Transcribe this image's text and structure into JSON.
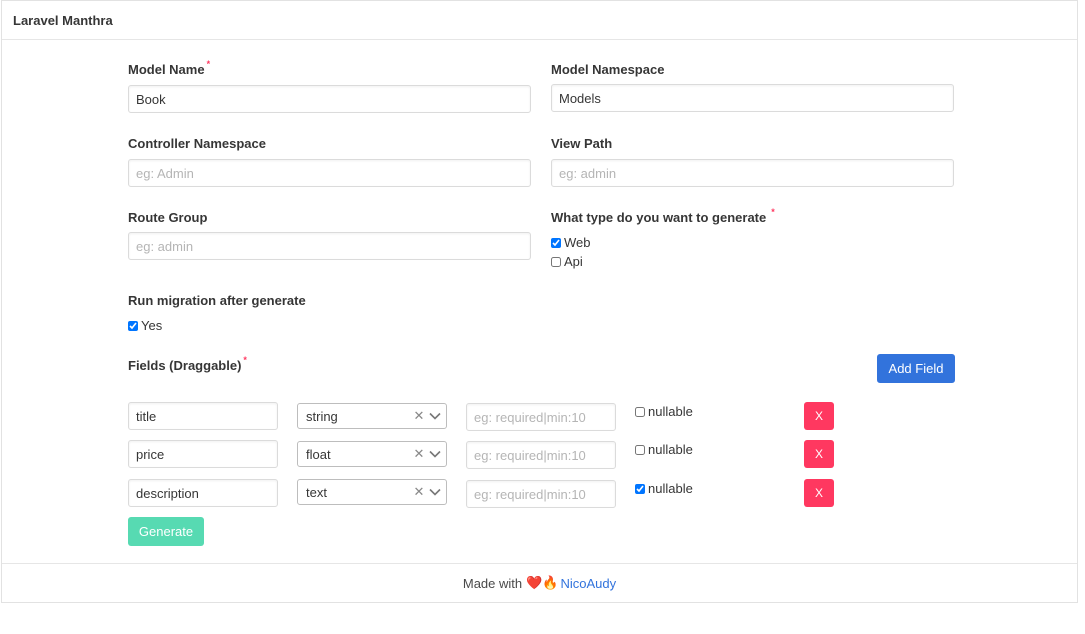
{
  "header": {
    "title": "Laravel Manthra"
  },
  "form": {
    "model_name": {
      "label": "Model Name",
      "required": "*",
      "value": "Book"
    },
    "model_namespace": {
      "label": "Model Namespace",
      "value": "Models"
    },
    "controller_namespace": {
      "label": "Controller Namespace",
      "placeholder": "eg: Admin",
      "value": ""
    },
    "view_path": {
      "label": "View Path",
      "placeholder": "eg: admin",
      "value": ""
    },
    "route_group": {
      "label": "Route Group",
      "placeholder": "eg: admin",
      "value": ""
    },
    "generate_type": {
      "label": "What type do you want to generate",
      "required": "*",
      "options": [
        {
          "label": "Web",
          "checked": true
        },
        {
          "label": "Api",
          "checked": false
        }
      ]
    },
    "migration": {
      "label": "Run migration after generate",
      "option": {
        "label": "Yes",
        "checked": true
      }
    },
    "fields_section": {
      "label": "Fields (Draggable)",
      "required": "*",
      "add_label": "Add Field"
    },
    "fields": [
      {
        "name": "title",
        "type": "string",
        "rules_placeholder": "eg: required|min:10",
        "nullable_label": "nullable",
        "nullable": false,
        "remove_label": "X"
      },
      {
        "name": "price",
        "type": "float",
        "rules_placeholder": "eg: required|min:10",
        "nullable_label": "nullable",
        "nullable": false,
        "remove_label": "X"
      },
      {
        "name": "description",
        "type": "text",
        "rules_placeholder": "eg: required|min:10",
        "nullable_label": "nullable",
        "nullable": true,
        "remove_label": "X"
      }
    ],
    "submit_label": "Generate"
  },
  "footer": {
    "prefix": "Made with",
    "heart": "❤️",
    "fire": "🔥",
    "author": "NicoAudy"
  },
  "colors": {
    "primary": "#3273dc",
    "danger": "#ff3860",
    "success": "#3ad4a5"
  },
  "icons": {
    "clear": "clear-icon",
    "dropdown": "chevron-down-icon",
    "heart": "heart-icon",
    "fire": "fire-icon"
  }
}
